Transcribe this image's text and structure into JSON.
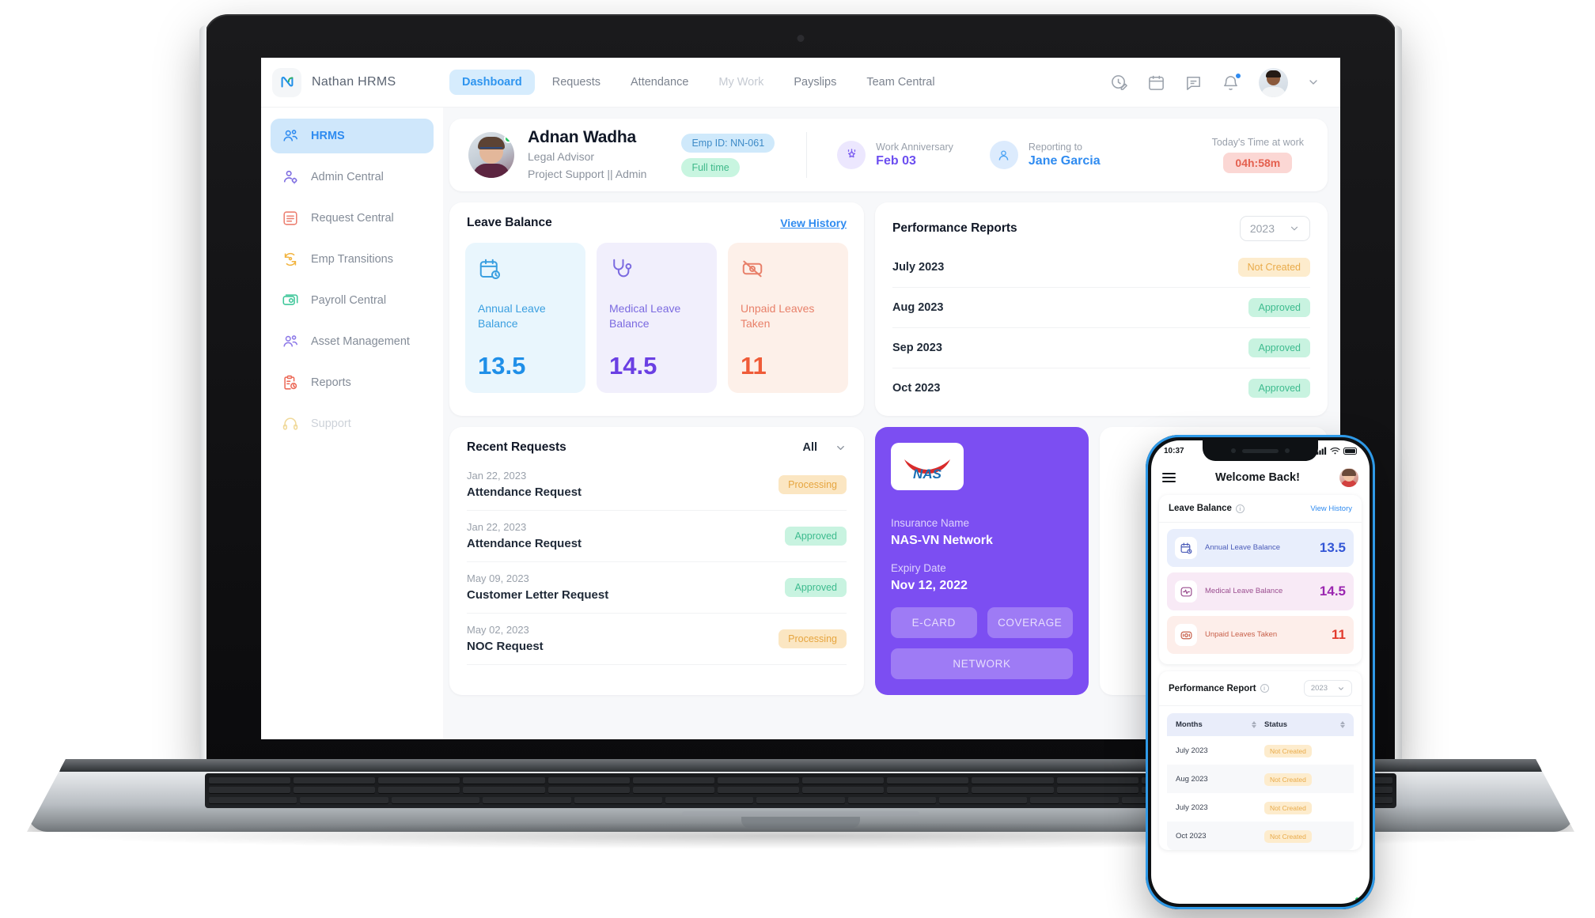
{
  "brand": {
    "name": "Nathan  HRMS",
    "logo_icon": "nathan-logo-icon"
  },
  "topnav": {
    "tabs": [
      {
        "label": "Dashboard",
        "state": "active"
      },
      {
        "label": "Requests",
        "state": "normal"
      },
      {
        "label": "Attendance",
        "state": "normal"
      },
      {
        "label": "My Work",
        "state": "muted"
      },
      {
        "label": "Payslips",
        "state": "normal"
      },
      {
        "label": "Team Central",
        "state": "normal"
      }
    ],
    "icons": [
      "time-edit-icon",
      "calendar-icon",
      "chat-icon",
      "bell-icon"
    ],
    "avatar_icon": "user-avatar",
    "chevron_icon": "chevron-down-icon"
  },
  "sidebar": {
    "items": [
      {
        "label": "HRMS",
        "icon": "people-icon",
        "state": "active"
      },
      {
        "label": "Admin Central",
        "icon": "user-gear-icon",
        "state": "normal"
      },
      {
        "label": "Request Central",
        "icon": "list-box-icon",
        "state": "normal"
      },
      {
        "label": "Emp Transitions",
        "icon": "transfer-icon",
        "state": "normal"
      },
      {
        "label": "Payroll Central",
        "icon": "money-icon",
        "state": "normal"
      },
      {
        "label": "Asset Management",
        "icon": "people-icon",
        "state": "normal"
      },
      {
        "label": "Reports",
        "icon": "clipboard-clock-icon",
        "state": "normal"
      },
      {
        "label": "Support",
        "icon": "headset-icon",
        "state": "disabled"
      }
    ]
  },
  "profile": {
    "name": "Adnan Wadha",
    "role": "Legal Advisor",
    "department": "Project Support || Admin",
    "emp_id_badge": "Emp ID: NN-061",
    "employment_badge": "Full time",
    "anniversary_label": "Work Anniversary",
    "anniversary_value": "Feb 03",
    "reporting_label": "Reporting to",
    "reporting_value": "Jane Garcia",
    "time_label": "Today's Time at work",
    "time_value": "04h:58m"
  },
  "leave_balance": {
    "title": "Leave Balance",
    "view_history": "View History",
    "tiles": [
      {
        "label": "Annual Leave Balance",
        "value": "13.5",
        "icon": "calendar-clock-icon"
      },
      {
        "label": "Medical Leave Balance",
        "value": "14.5",
        "icon": "stethoscope-icon"
      },
      {
        "label": "Unpaid Leaves Taken",
        "value": "11",
        "icon": "no-money-icon"
      }
    ]
  },
  "performance": {
    "title": "Performance Reports",
    "year": "2023",
    "rows": [
      {
        "month": "July 2023",
        "status": "Not Created",
        "tone": "notcreated"
      },
      {
        "month": "Aug 2023",
        "status": "Approved",
        "tone": "approved"
      },
      {
        "month": "Sep 2023",
        "status": "Approved",
        "tone": "approved"
      },
      {
        "month": "Oct 2023",
        "status": "Approved",
        "tone": "approved"
      }
    ]
  },
  "recent_requests": {
    "title": "Recent Requests",
    "filter": "All",
    "rows": [
      {
        "date": "Jan 22, 2023",
        "title": "Attendance Request",
        "status": "Processing",
        "tone": "processing"
      },
      {
        "date": "Jan 22, 2023",
        "title": "Attendance Request",
        "status": "Approved",
        "tone": "approved"
      },
      {
        "date": "May 09, 2023",
        "title": "Customer Letter Request",
        "status": "Approved",
        "tone": "approved"
      },
      {
        "date": "May 02, 2023",
        "title": "NOC Request",
        "status": "Processing",
        "tone": "processing"
      }
    ]
  },
  "insurance": {
    "logo_text": "NAS",
    "name_label": "Insurance Name",
    "name_value": "NAS-VN Network",
    "expiry_label": "Expiry Date",
    "expiry_value": "Nov 12, 2022",
    "btn_ecard": "E-CARD",
    "btn_coverage": "COVERAGE",
    "btn_network": "NETWORK",
    "accent_color": "#7c4ef2"
  },
  "phone": {
    "status_time": "10:37",
    "title": "Welcome Back!",
    "leave_balance": {
      "title": "Leave Balance",
      "view_history": "View History",
      "rows": [
        {
          "label": "Annual Leave Balance",
          "value": "13.5",
          "icon": "calendar-clock-icon"
        },
        {
          "label": "Medical Leave Balance",
          "value": "14.5",
          "icon": "heartbeat-icon"
        },
        {
          "label": "Unpaid Leaves Taken",
          "value": "11",
          "icon": "no-money-icon"
        }
      ]
    },
    "performance": {
      "title": "Performance Report",
      "year": "2023",
      "col_months": "Months",
      "col_status": "Status",
      "rows": [
        {
          "month": "July 2023",
          "status": "Not Created"
        },
        {
          "month": "Aug 2023",
          "status": "Not Created"
        },
        {
          "month": "July 2023",
          "status": "Not Created"
        },
        {
          "month": "Oct 2023",
          "status": "Not Created"
        }
      ]
    }
  }
}
